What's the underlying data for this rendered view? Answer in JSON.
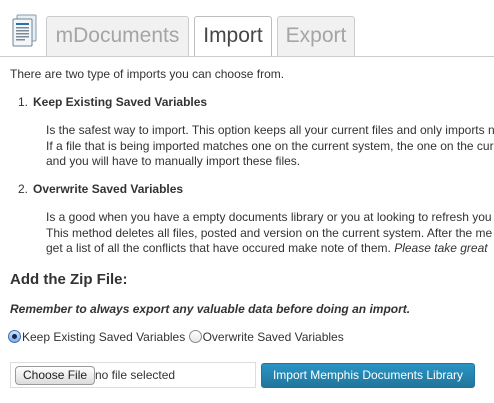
{
  "tabs": {
    "mdocuments": "mDocuments",
    "import": "Import",
    "export": "Export"
  },
  "intro": "There are two type of imports you can choose from.",
  "options": [
    {
      "number": "1.",
      "title": "Keep Existing Saved Variables",
      "desc_lines": [
        "Is the safest way to import. This option keeps all your current files and only imports n",
        "If a file that is being imported matches one on the current system, the one on the cur",
        "and you will have to manually import these files."
      ]
    },
    {
      "number": "2.",
      "title": "Overwrite Saved Variables",
      "desc_lines": [
        "Is a good when you have a empty documents library or you at looking to refresh you",
        "This method deletes all files, posted and version on the current system. After the me",
        "get a list of all the conflicts that have occured make note of them."
      ],
      "desc_emphasis": "Please take great"
    }
  ],
  "zip_heading": "Add the Zip File:",
  "reminder": "Remember to always export any valuable data before doing an import.",
  "radios": {
    "keep_label": "Keep Existing Saved Variables",
    "overwrite_label": "Overwrite Saved Variables",
    "selected": "keep"
  },
  "file_input": {
    "button_label": "Choose File",
    "status": "no file selected"
  },
  "import_button": "Import Memphis Documents Library",
  "colors": {
    "primary_button": "#21759b",
    "tab_border": "#cccccc"
  },
  "icons": {
    "app": "document-stack-icon"
  }
}
